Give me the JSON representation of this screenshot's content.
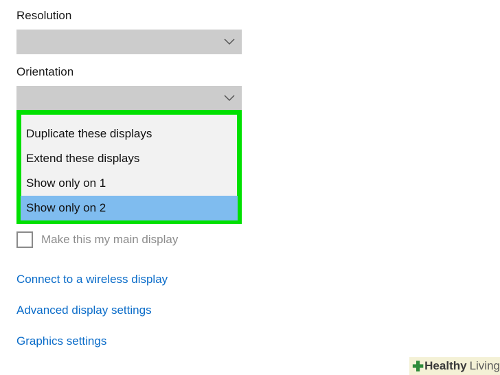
{
  "resolution": {
    "label": "Resolution",
    "value": ""
  },
  "orientation": {
    "label": "Orientation",
    "value": ""
  },
  "dropdown": {
    "options": [
      {
        "label": "Duplicate these displays"
      },
      {
        "label": "Extend these displays"
      },
      {
        "label": "Show only on 1"
      },
      {
        "label": "Show only on 2"
      }
    ],
    "selected_index": 3,
    "highlight_color": "#00e000",
    "selected_color": "#7fbcef"
  },
  "main_display_checkbox": {
    "label": "Make this my main display",
    "checked": false
  },
  "links": {
    "wireless": "Connect to a wireless display",
    "advanced": "Advanced display settings",
    "graphics": "Graphics settings"
  },
  "watermark": {
    "brand_bold": "Healthy",
    "brand_light": "Living"
  },
  "colors": {
    "link": "#0a6cc9",
    "combo_bg": "#cccccc"
  }
}
